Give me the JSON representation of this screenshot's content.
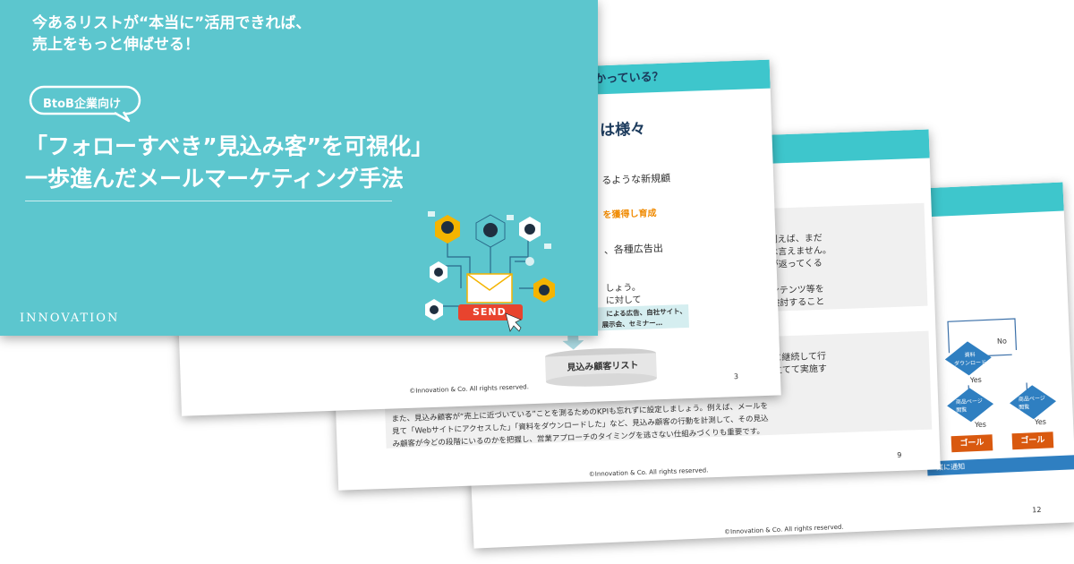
{
  "cover": {
    "headline_line1": "今あるリストが“本当に”活用できれば、",
    "headline_line2": "売上をもっと伸ばせる！",
    "badge": "BtoB企業向け",
    "title_line1": "「フォローすべき”見込み客”を可視化」",
    "title_line2": "一歩進んだメールマーケティング手法",
    "brand": "INNOVATION",
    "send_label": "SEND"
  },
  "slide2": {
    "header": "かっている？",
    "heading": "は様々",
    "line1": "るような新規顧",
    "line2_highlight": "を獲得し育成",
    "line3": "、各種広告出",
    "line4": "しょう。",
    "line5": "に対して",
    "channels": "による広告、自社サイト、",
    "channels2": "DM、キャンペーン、展示会、セミナー…",
    "db_label": "見込み顧客リスト",
    "footer": "©Innovation & Co.  All rights reserved.",
    "page": "3"
  },
  "slide3": {
    "text1": "例えば、まだ",
    "text2": "は言えません。",
    "text3": "が返ってくる",
    "text4": "ンテンツ等を",
    "text5": "検討すること",
    "text6": "に継続して行",
    "text7": "立てて実施す",
    "para1": "また、見込み顧客が“売上に近づいている”ことを測るためのKPIも忘れずに設定しましょう。例えば、メールを",
    "para2": "見て「Webサイトにアクセスした」「資料をダウンロードした」など、見込み顧客の行動を計測して、その見込",
    "para3": "み顧客が今どの段階にいるのかを把握し、営業アプローチのタイミングを逃さない仕組みづくりも重要です。",
    "footer": "©Innovation & Co.  All rights reserved.",
    "page": "9"
  },
  "slide4": {
    "decision1": "資料\nダウンロード",
    "decision2": "商品ページ\n閲覧",
    "decision3": "商品ページ\n閲覧",
    "no_label": "No",
    "yes1": "Yes",
    "yes2": "Yes",
    "yes3": "Yes",
    "goal1": "ゴール",
    "goal2": "ゴール",
    "notify": "業に通知",
    "footer": "©Innovation & Co.  All rights reserved.",
    "page": "12"
  },
  "colors": {
    "teal": "#5cc6ce",
    "bar": "#3ec6cc",
    "navy": "#1b3a5c",
    "orange": "#d9590f",
    "blue": "#2f7fc1"
  }
}
